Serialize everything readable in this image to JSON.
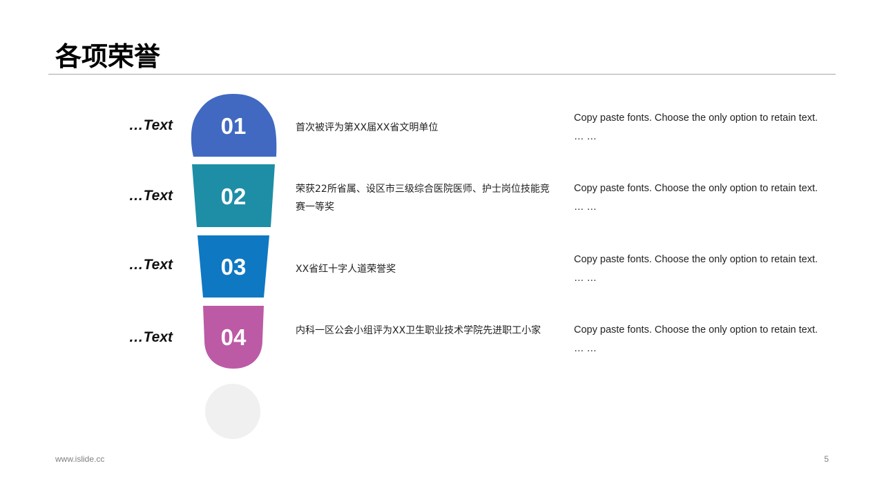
{
  "title": "各项荣誉",
  "rows": [
    {
      "number": "01",
      "label": "…Text",
      "description": "首次被评为第XX届XX省文明单位",
      "note": "Copy paste fonts. Choose the only option to retain text.\n… …",
      "color": "#4169c1"
    },
    {
      "number": "02",
      "label": "…Text",
      "description": "荣获22所省属、设区市三级综合医院医师、护士岗位技能竞赛一等奖",
      "note": "Copy paste fonts. Choose the only option to retain text.\n… …",
      "color": "#1e8ea6"
    },
    {
      "number": "03",
      "label": "…Text",
      "description": "XX省红十字人道荣誉奖",
      "note": "Copy paste fonts. Choose the only option to retain text.\n… …",
      "color": "#0f78c2"
    },
    {
      "number": "04",
      "label": "…Text",
      "description": "内科一区公会小组评为XX卫生职业技术学院先进职工小家",
      "note": "Copy paste fonts. Choose the only option to retain text.\n… …",
      "color": "#bc5aa6"
    }
  ],
  "dot_color": "#f0f0f0",
  "footer": {
    "website": "www.islide.cc",
    "page_number": "5"
  }
}
